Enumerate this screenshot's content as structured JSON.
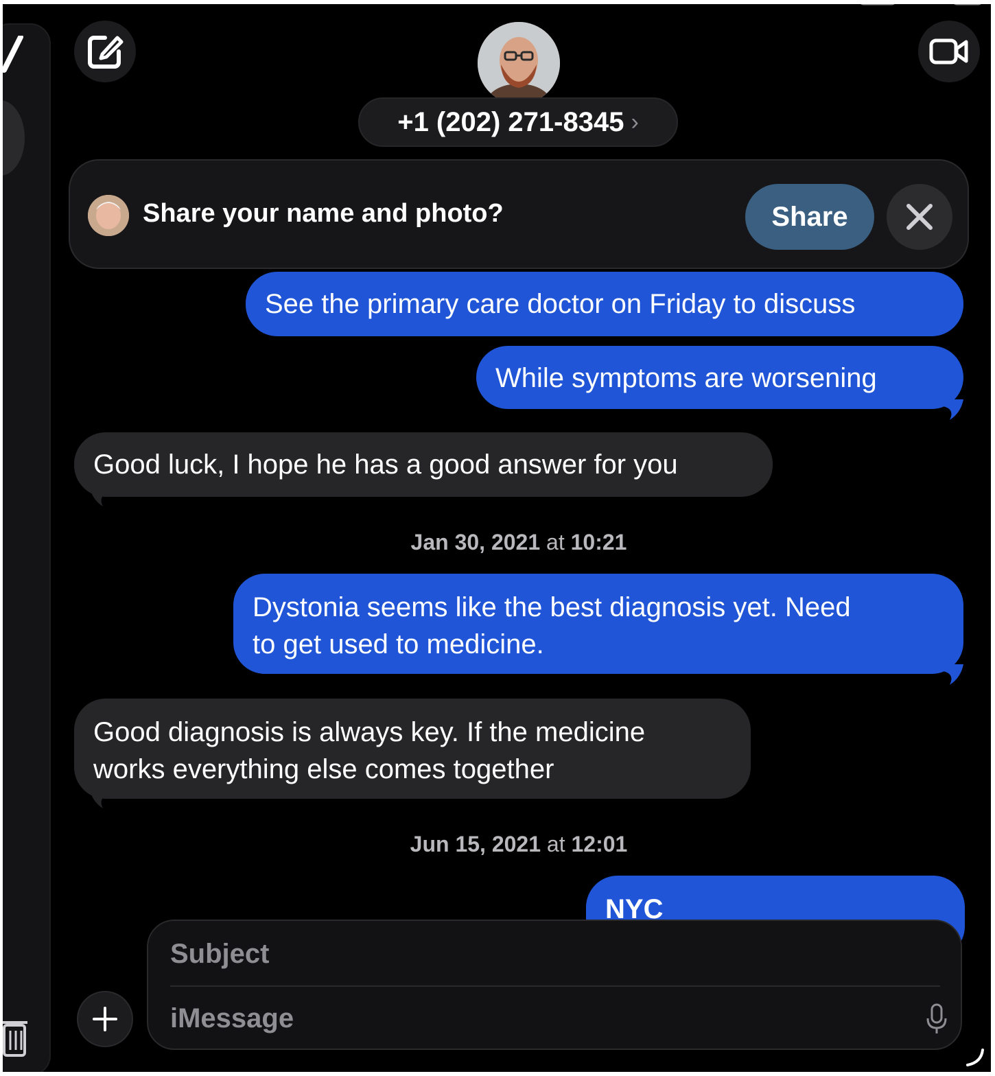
{
  "header": {
    "contact_number": "+1 (202) 271-8345",
    "contact_chevron": "›"
  },
  "banner": {
    "text": "Share your name and photo?",
    "share_label": "Share"
  },
  "messages": [
    {
      "from": "me",
      "text": "See the primary care doctor on Friday to discuss"
    },
    {
      "from": "me",
      "text": "While symptoms are worsening"
    },
    {
      "from": "them",
      "text": "Good luck, I hope he has a good answer for you"
    },
    {
      "from": "me",
      "lines": [
        "Dystonia seems like the best diagnosis yet. Need",
        "to get used to medicine."
      ]
    },
    {
      "from": "them",
      "lines": [
        "Good diagnosis is always key. If the medicine",
        "works everything else comes together"
      ]
    },
    {
      "from": "me",
      "text": "NYC"
    }
  ],
  "timestamps": [
    {
      "date": "Jan 30, 2021",
      "at": "at",
      "time": "10:21"
    },
    {
      "date": "Jun 15, 2021",
      "at": "at",
      "time": "12:01"
    }
  ],
  "composer": {
    "subject_placeholder": "Subject",
    "message_placeholder": "iMessage"
  },
  "colors": {
    "sent_bubble": "#1f55d6",
    "received_bubble": "#262628",
    "share_button": "#3a5f80",
    "background": "#000000"
  },
  "icons": [
    "compose-icon",
    "video-call-icon",
    "close-icon",
    "plus-icon",
    "microphone-icon",
    "trash-icon",
    "checkmark-icon"
  ]
}
